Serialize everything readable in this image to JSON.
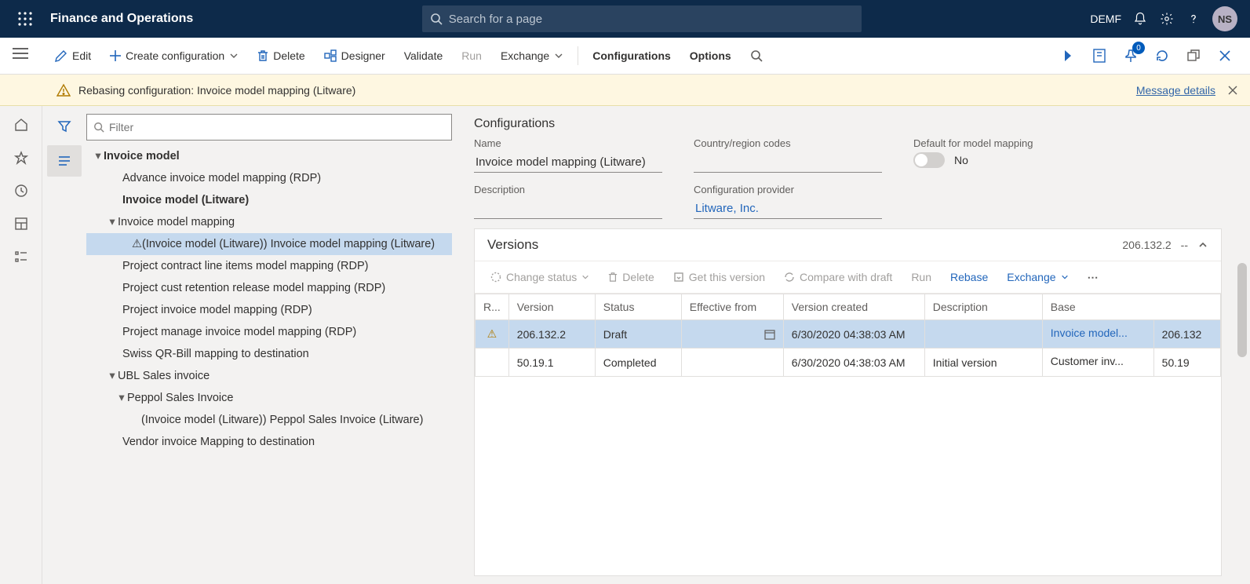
{
  "header": {
    "app_title": "Finance and Operations",
    "search_placeholder": "Search for a page",
    "company": "DEMF",
    "avatar_initials": "NS"
  },
  "toolbar": {
    "edit": "Edit",
    "create": "Create configuration",
    "delete": "Delete",
    "designer": "Designer",
    "validate": "Validate",
    "run": "Run",
    "exchange": "Exchange",
    "configurations": "Configurations",
    "options": "Options",
    "notif_badge": "0"
  },
  "notification": {
    "text": "Rebasing configuration: Invoice model mapping (Litware)",
    "details_link": "Message details"
  },
  "filter": {
    "placeholder": "Filter"
  },
  "tree": {
    "root": "Invoice model",
    "n1": "Advance invoice model mapping (RDP)",
    "n2": "Invoice model (Litware)",
    "n3": "Invoice model mapping",
    "n3a": "⚠(Invoice model (Litware)) Invoice model mapping (Litware)",
    "n4": "Project contract line items model mapping (RDP)",
    "n5": "Project cust retention release model mapping (RDP)",
    "n6": "Project invoice model mapping (RDP)",
    "n7": "Project manage invoice model mapping (RDP)",
    "n8": "Swiss QR-Bill mapping to destination",
    "n9": "UBL Sales invoice",
    "n9a": "Peppol Sales Invoice",
    "n9a1": "(Invoice model (Litware)) Peppol Sales Invoice (Litware)",
    "n10": "Vendor invoice Mapping to destination"
  },
  "details": {
    "section": "Configurations",
    "name_label": "Name",
    "name_value": "Invoice model mapping (Litware)",
    "country_label": "Country/region codes",
    "country_value": "",
    "default_label": "Default for model mapping",
    "default_value": "No",
    "desc_label": "Description",
    "desc_value": "",
    "provider_label": "Configuration provider",
    "provider_value": "Litware, Inc."
  },
  "versions": {
    "title": "Versions",
    "current": "206.132.2",
    "dash": "--",
    "tools": {
      "change_status": "Change status",
      "delete": "Delete",
      "get": "Get this version",
      "compare": "Compare with draft",
      "run": "Run",
      "rebase": "Rebase",
      "exchange": "Exchange"
    },
    "cols": {
      "r": "R...",
      "version": "Version",
      "status": "Status",
      "effective": "Effective from",
      "created": "Version created",
      "desc": "Description",
      "base": "Base"
    },
    "rows": [
      {
        "warn": true,
        "version": "206.132.2",
        "status": "Draft",
        "effective": "",
        "created": "6/30/2020 04:38:03 AM",
        "desc": "",
        "base_name": "Invoice model...",
        "base_ver": "206.132"
      },
      {
        "warn": false,
        "version": "50.19.1",
        "status": "Completed",
        "effective": "",
        "created": "6/30/2020 04:38:03 AM",
        "desc": "Initial version",
        "base_name": "Customer inv...",
        "base_ver": "50.19"
      }
    ]
  }
}
